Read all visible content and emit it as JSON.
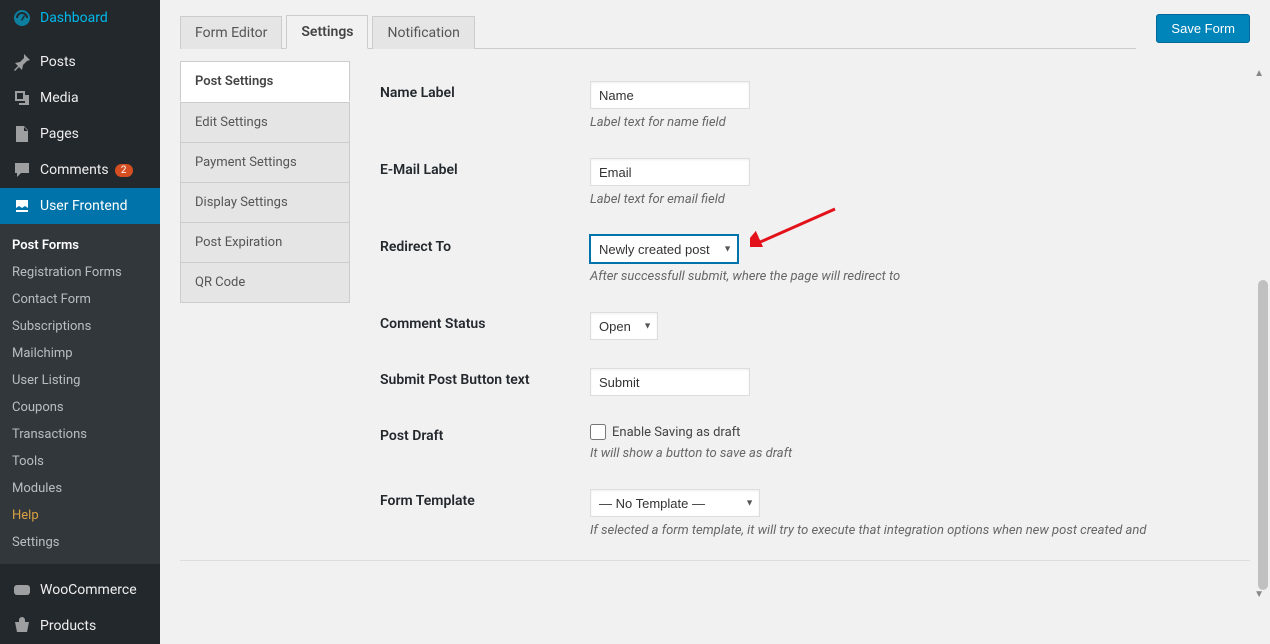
{
  "sidebar": {
    "items": [
      {
        "id": "dashboard",
        "label": "Dashboard",
        "icon": "gauge"
      },
      {
        "id": "posts",
        "label": "Posts",
        "icon": "pin"
      },
      {
        "id": "media",
        "label": "Media",
        "icon": "media"
      },
      {
        "id": "pages",
        "label": "Pages",
        "icon": "page"
      },
      {
        "id": "comments",
        "label": "Comments",
        "icon": "comment",
        "badge": "2"
      },
      {
        "id": "user-frontend",
        "label": "User Frontend",
        "icon": "wpuf",
        "active": true
      },
      {
        "id": "woocommerce",
        "label": "WooCommerce",
        "icon": "woo",
        "gap": true
      },
      {
        "id": "products",
        "label": "Products",
        "icon": "product"
      }
    ],
    "submenu": [
      {
        "label": "Post Forms",
        "current": true
      },
      {
        "label": "Registration Forms"
      },
      {
        "label": "Contact Form"
      },
      {
        "label": "Subscriptions"
      },
      {
        "label": "Mailchimp"
      },
      {
        "label": "User Listing"
      },
      {
        "label": "Coupons"
      },
      {
        "label": "Transactions"
      },
      {
        "label": "Tools"
      },
      {
        "label": "Modules"
      },
      {
        "label": "Help",
        "help": true
      },
      {
        "label": "Settings"
      }
    ]
  },
  "header": {
    "tabs": [
      {
        "label": "Form Editor"
      },
      {
        "label": "Settings",
        "active": true
      },
      {
        "label": "Notification"
      }
    ],
    "save": "Save Form"
  },
  "leftTabs": [
    {
      "label": "Post Settings",
      "active": true
    },
    {
      "label": "Edit Settings"
    },
    {
      "label": "Payment Settings"
    },
    {
      "label": "Display Settings"
    },
    {
      "label": "Post Expiration"
    },
    {
      "label": "QR Code"
    }
  ],
  "fields": {
    "name_label": {
      "label": "Name Label",
      "value": "Name",
      "help": "Label text for name field"
    },
    "email_label": {
      "label": "E-Mail Label",
      "value": "Email",
      "help": "Label text for email field"
    },
    "redirect": {
      "label": "Redirect To",
      "value": "Newly created post",
      "help": "After successfull submit, where the page will redirect to"
    },
    "comment": {
      "label": "Comment Status",
      "value": "Open"
    },
    "submit_btn": {
      "label": "Submit Post Button text",
      "value": "Submit"
    },
    "draft": {
      "label": "Post Draft",
      "checkbox": "Enable Saving as draft",
      "help": "It will show a button to save as draft"
    },
    "template": {
      "label": "Form Template",
      "value": "— No Template —",
      "help": "If selected a form template, it will try to execute that integration options when new post created and"
    }
  }
}
